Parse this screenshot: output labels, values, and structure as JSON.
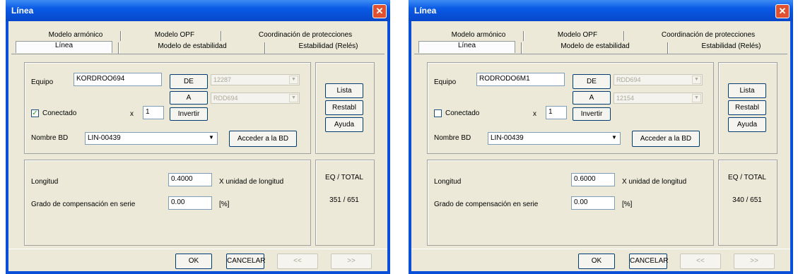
{
  "dialogs": [
    {
      "title": "Línea",
      "tabs_row1": [
        "Modelo armónico",
        "Modelo OPF",
        "Coordinación de protecciones"
      ],
      "tabs_row2": [
        "Línea",
        "Modelo de estabilidad",
        "Estabilidad (Relés)"
      ],
      "equipo_label": "Equipo",
      "equipo_value": "KORDROO694",
      "de_label": "DE",
      "a_label": "A",
      "de_value": "12287",
      "a_value": "RDD694",
      "conectado_label": "Conectado",
      "conectado_checked": true,
      "conectado_mark": "✓",
      "x_label": "x",
      "x_value": "1",
      "invertir_label": "Invertir",
      "nombre_bd_label": "Nombre BD",
      "nombre_bd_value": "LIN-00439",
      "acceder_label": "Acceder a la BD",
      "lista_label": "Lista",
      "restabl_label": "Restabl",
      "ayuda_label": "Ayuda",
      "longitud_label": "Longitud",
      "longitud_value": "0.4000",
      "unit_label": "X unidad de longitud",
      "grado_label": "Grado de compensación en serie",
      "grado_value": "0.00",
      "pct_label": "[%]",
      "eq_total_label": "EQ / TOTAL",
      "eq_total_value": "351 / 651",
      "ok_label": "OK",
      "cancel_label": "CANCELAR",
      "prev_label": "<<",
      "next_label": ">>"
    },
    {
      "title": "Línea",
      "tabs_row1": [
        "Modelo armónico",
        "Modelo OPF",
        "Coordinación de protecciones"
      ],
      "tabs_row2": [
        "Línea",
        "Modelo de estabilidad",
        "Estabilidad (Relés)"
      ],
      "equipo_label": "Equipo",
      "equipo_value": "RODRODO6M1",
      "de_label": "DE",
      "a_label": "A",
      "de_value": "RDD694",
      "a_value": "12154",
      "conectado_label": "Conectado",
      "conectado_checked": false,
      "conectado_mark": "",
      "x_label": "x",
      "x_value": "1",
      "invertir_label": "Invertir",
      "nombre_bd_label": "Nombre BD",
      "nombre_bd_value": "LIN-00439",
      "acceder_label": "Acceder a la BD",
      "lista_label": "Lista",
      "restabl_label": "Restabl",
      "ayuda_label": "Ayuda",
      "longitud_label": "Longitud",
      "longitud_value": "0.6000",
      "unit_label": "X unidad de longitud",
      "grado_label": "Grado de compensación en serie",
      "grado_value": "0.00",
      "pct_label": "[%]",
      "eq_total_label": "EQ / TOTAL",
      "eq_total_value": "340 / 651",
      "ok_label": "OK",
      "cancel_label": "CANCELAR",
      "prev_label": "<<",
      "next_label": ">>"
    }
  ],
  "icons": {
    "close": "close-icon",
    "check": "checkmark-icon",
    "dropdown": "chevron-down-icon"
  },
  "colors": {
    "titlebar": "#0a5ae6",
    "dialog_bg": "#ece9d8",
    "close_button": "#e2512f"
  }
}
